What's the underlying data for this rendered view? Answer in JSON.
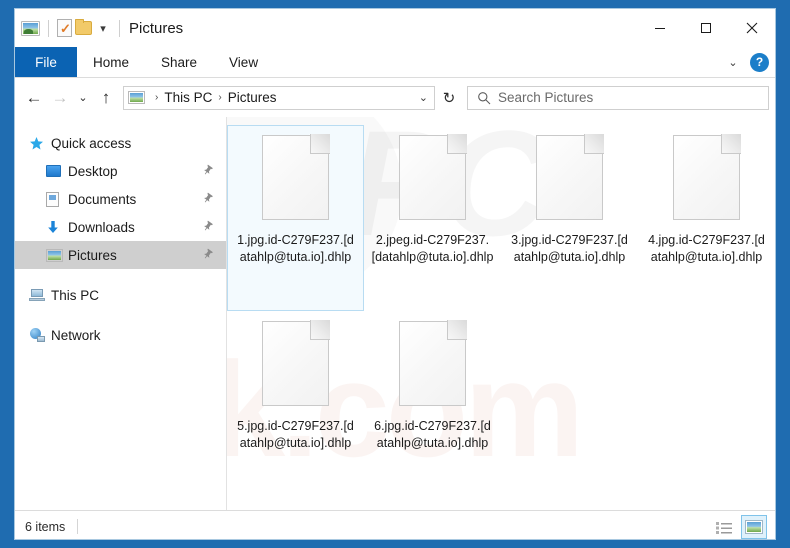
{
  "window": {
    "title": "Pictures",
    "quick_access_toolbar": [
      {
        "name": "pictures-folder-icon",
        "label": "Pictures"
      },
      {
        "name": "properties-icon",
        "label": "Properties"
      },
      {
        "name": "new-folder-icon",
        "label": "New folder"
      },
      {
        "name": "customize-qat-chevron-icon",
        "label": "▾"
      }
    ],
    "controls": {
      "minimize": "─",
      "maximize": "□",
      "close": "✕"
    }
  },
  "ribbon": {
    "tabs": [
      {
        "label": "File",
        "active": true
      },
      {
        "label": "Home",
        "active": false
      },
      {
        "label": "Share",
        "active": false
      },
      {
        "label": "View",
        "active": false
      }
    ],
    "expand_chevron": "⌄",
    "help_label": "?"
  },
  "address_bar": {
    "back": "←",
    "forward": "→",
    "recent_chevron": "⌄",
    "up": "↑",
    "breadcrumbs": [
      "This PC",
      "Pictures"
    ],
    "separator": "›",
    "dropdown_chevron": "⌄",
    "refresh": "↻"
  },
  "search": {
    "placeholder": "Search Pictures",
    "value": ""
  },
  "sidebar": {
    "items": [
      {
        "label": "Quick access",
        "icon": "star-icon",
        "indent": false,
        "pinned": false,
        "selected": false
      },
      {
        "label": "Desktop",
        "icon": "desktop-icon",
        "indent": true,
        "pinned": true,
        "selected": false
      },
      {
        "label": "Documents",
        "icon": "documents-icon",
        "indent": true,
        "pinned": true,
        "selected": false
      },
      {
        "label": "Downloads",
        "icon": "downloads-icon",
        "indent": true,
        "pinned": true,
        "selected": false
      },
      {
        "label": "Pictures",
        "icon": "pictures-icon",
        "indent": true,
        "pinned": true,
        "selected": true
      },
      {
        "label": "This PC",
        "icon": "this-pc-icon",
        "indent": false,
        "pinned": false,
        "selected": false
      },
      {
        "label": "Network",
        "icon": "network-icon",
        "indent": false,
        "pinned": false,
        "selected": false
      }
    ],
    "pin_glyph": "📌"
  },
  "files": [
    {
      "name": "1.jpg.id-C279F237.[datahlp@tuta.io].dhlp",
      "icon": "blank-file-icon",
      "selected": true
    },
    {
      "name": "2.jpeg.id-C279F237.[datahlp@tuta.io].dhlp",
      "icon": "blank-file-icon",
      "selected": false
    },
    {
      "name": "3.jpg.id-C279F237.[datahlp@tuta.io].dhlp",
      "icon": "blank-file-icon",
      "selected": false
    },
    {
      "name": "4.jpg.id-C279F237.[datahlp@tuta.io].dhlp",
      "icon": "blank-file-icon",
      "selected": false
    },
    {
      "name": "5.jpg.id-C279F237.[datahlp@tuta.io].dhlp",
      "icon": "blank-file-icon",
      "selected": false
    },
    {
      "name": "6.jpg.id-C279F237.[datahlp@tuta.io].dhlp",
      "icon": "blank-file-icon",
      "selected": false
    }
  ],
  "status_bar": {
    "item_count": "6 items",
    "views": [
      {
        "name": "details-view-button",
        "active": false
      },
      {
        "name": "large-icons-view-button",
        "active": true
      }
    ]
  },
  "watermark": {
    "top_text": "PC",
    "bottom_text": "risk.com"
  },
  "colors": {
    "window_frame": "#1f6cb0",
    "file_tab": "#0b63b3",
    "help_circle": "#1b7ec9",
    "selection": "#cfcfcf",
    "tile_selection_border": "#b8dcf2"
  }
}
